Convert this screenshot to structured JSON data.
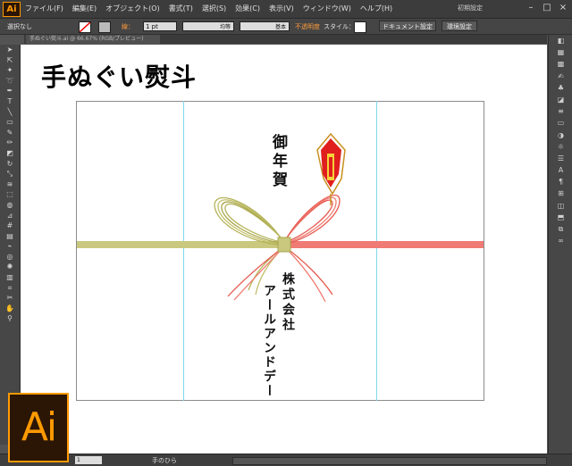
{
  "app": {
    "logo_text": "Ai"
  },
  "menu": [
    "ファイル(F)",
    "編集(E)",
    "オブジェクト(O)",
    "書式(T)",
    "選択(S)",
    "効果(C)",
    "表示(V)",
    "ウィンドウ(W)",
    "ヘルプ(H)"
  ],
  "workspace": "初期設定",
  "control": {
    "selection_status": "選択なし",
    "stroke_label": "線：",
    "stroke_weight": "1 pt",
    "profile_uniform": "均等",
    "brush_basic": "基本",
    "opacity_label": "不透明度",
    "style_label": "スタイル：",
    "doc_setup_button": "ドキュメント設定",
    "prefs_button": "環境設定"
  },
  "tab": {
    "title": "手ぬぐい熨斗.ai @ 66.67% (RGB/プレビュー)"
  },
  "artwork": {
    "title": "手ぬぐい熨斗",
    "greeting": "御年賀",
    "company_line1": "株式会社",
    "company_line2": "アールアンドデー"
  },
  "status": {
    "zoom": "1",
    "current_tool": "手のひら"
  },
  "colors": {
    "accent": "#ff9a00",
    "red_cord": "#e8564e",
    "gold_cord": "#b7b45c",
    "guide": "#7fd8ee"
  },
  "icons": [
    "selection-icon",
    "direct-selection-icon",
    "magic-wand-icon",
    "lasso-icon",
    "pen-icon",
    "type-icon",
    "line-icon",
    "rectangle-icon",
    "paintbrush-icon",
    "pencil-icon",
    "eraser-icon",
    "rotate-icon",
    "scale-icon",
    "warp-icon",
    "free-transform-icon",
    "shape-builder-icon",
    "perspective-icon",
    "mesh-icon",
    "gradient-icon",
    "eyedropper-icon",
    "blend-icon",
    "symbol-sprayer-icon",
    "graph-icon",
    "artboard-icon",
    "slice-icon",
    "hand-icon",
    "zoom-icon"
  ]
}
